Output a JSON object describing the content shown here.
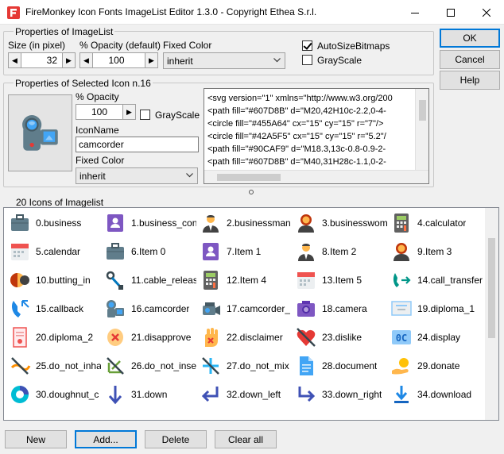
{
  "window": {
    "title": "FireMonkey Icon Fonts ImageList Editor 1.3.0 - Copyright Ethea S.r.l."
  },
  "imagelist": {
    "legend": "Properties of ImageList",
    "size_label": "Size (in pixel)",
    "size_value": "32",
    "opacity_label": "% Opacity (default)",
    "opacity_value": "100",
    "fixed_color_label": "Fixed Color",
    "fixed_color_value": "inherit",
    "autosize_label": "AutoSizeBitmaps",
    "autosize_checked": true,
    "grayscale_label": "GrayScale",
    "grayscale_checked": false
  },
  "selected_icon": {
    "legend": "Properties of Selected Icon n.16",
    "opacity_label": "% Opacity",
    "opacity_value": "100",
    "grayscale_label": "GrayScale",
    "grayscale_checked": false,
    "iconname_label": "IconName",
    "iconname_value": "camcorder",
    "fixed_color_label": "Fixed Color",
    "fixed_color_value": "inherit",
    "svg_lines": [
      "<svg version=\"1\" xmlns=\"http://www.w3.org/200",
      "  <path fill=\"#607D8B\" d=\"M20,42H10c-2.2,0-4-",
      "  <circle fill=\"#455A64\" cx=\"15\" cy=\"15\" r=\"7\"/>",
      "  <circle fill=\"#42A5F5\" cx=\"15\" cy=\"15\" r=\"5.2\"/",
      "  <path fill=\"#90CAF9\" d=\"M18.3,13c-0.8-0.9-2-",
      "  <path fill=\"#607D8B\" d=\"M40,31H28c-1.1,0-2-"
    ]
  },
  "dialog_buttons": {
    "ok": "OK",
    "cancel": "Cancel",
    "help": "Help"
  },
  "icons_panel": {
    "legend": "20 Icons of Imagelist",
    "items": [
      {
        "label": "0.business",
        "icon": "briefcase-icon"
      },
      {
        "label": "1.business_con",
        "icon": "contact-badge-icon"
      },
      {
        "label": "2.businessman",
        "icon": "businessman-icon"
      },
      {
        "label": "3.businesswom",
        "icon": "businesswoman-icon"
      },
      {
        "label": "4.calculator",
        "icon": "calculator-icon"
      },
      {
        "label": "5.calendar",
        "icon": "calendar-icon"
      },
      {
        "label": "6.Item 0",
        "icon": "briefcase-icon"
      },
      {
        "label": "7.Item 1",
        "icon": "contact-badge-icon"
      },
      {
        "label": "8.Item 2",
        "icon": "businessman-icon"
      },
      {
        "label": "9.Item 3",
        "icon": "businesswoman-icon"
      },
      {
        "label": "10.butting_in",
        "icon": "butting-in-icon"
      },
      {
        "label": "11.cable_releas",
        "icon": "cable-release-icon"
      },
      {
        "label": "12.Item 4",
        "icon": "calculator-icon"
      },
      {
        "label": "13.Item 5",
        "icon": "calendar-icon"
      },
      {
        "label": "14.call_transfer",
        "icon": "call-transfer-icon"
      },
      {
        "label": "15.callback",
        "icon": "callback-icon"
      },
      {
        "label": "16.camcorder",
        "icon": "camcorder-icon"
      },
      {
        "label": "17.camcorder_",
        "icon": "camcorder-pro-icon"
      },
      {
        "label": "18.camera",
        "icon": "camera-icon"
      },
      {
        "label": "19.diploma_1",
        "icon": "diploma-icon"
      },
      {
        "label": "20.diploma_2",
        "icon": "diploma-2-icon"
      },
      {
        "label": "21.disapprove",
        "icon": "disapprove-icon"
      },
      {
        "label": "22.disclaimer",
        "icon": "disclaimer-icon"
      },
      {
        "label": "23.dislike",
        "icon": "dislike-icon"
      },
      {
        "label": "24.display",
        "icon": "display-icon"
      },
      {
        "label": "25.do_not_inha",
        "icon": "do-not-inhale-icon"
      },
      {
        "label": "26.do_not_inse",
        "icon": "do-not-insert-icon"
      },
      {
        "label": "27.do_not_mix",
        "icon": "do-not-mix-icon"
      },
      {
        "label": "28.document",
        "icon": "document-icon"
      },
      {
        "label": "29.donate",
        "icon": "donate-icon"
      },
      {
        "label": "30.doughnut_c",
        "icon": "doughnut-chart-icon"
      },
      {
        "label": "31.down",
        "icon": "arrow-down-icon"
      },
      {
        "label": "32.down_left",
        "icon": "arrow-down-left-icon"
      },
      {
        "label": "33.down_right",
        "icon": "arrow-down-right-icon"
      },
      {
        "label": "34.download",
        "icon": "download-icon"
      }
    ]
  },
  "bottom_buttons": {
    "new": "New",
    "add": "Add...",
    "delete": "Delete",
    "clear_all": "Clear all"
  }
}
